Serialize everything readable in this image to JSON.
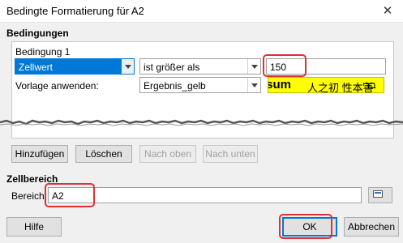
{
  "window": {
    "title": "Bedingte Formatierung für A2",
    "close_glyph": "✕"
  },
  "conditions": {
    "section_title": "Bedingungen",
    "condition_label": "Bedingung 1",
    "type_combo": "Zellwert",
    "operator_combo": "ist größer als",
    "value_input": "150",
    "apply_style_label": "Vorlage anwenden:",
    "style_combo": "Ergebnis_gelb",
    "preview": {
      "latin": "psum",
      "cjk": "人之初 性本善",
      "hebrew": "ברי"
    }
  },
  "buttons": {
    "add": "Hinzufügen",
    "delete": "Löschen",
    "up": "Nach oben",
    "down": "Nach unten",
    "help": "Hilfe",
    "ok": "OK",
    "cancel": "Abbrechen"
  },
  "cell_range": {
    "section_title": "Zellbereich",
    "range_label": "Bereich:",
    "range_value": "A2"
  },
  "colors": {
    "accent": "#0078d7",
    "highlight": "#e03030",
    "preview_bg": "#ffff00"
  },
  "icons": [
    "close-icon",
    "chevron-down-icon",
    "shrink-dialog-icon"
  ]
}
